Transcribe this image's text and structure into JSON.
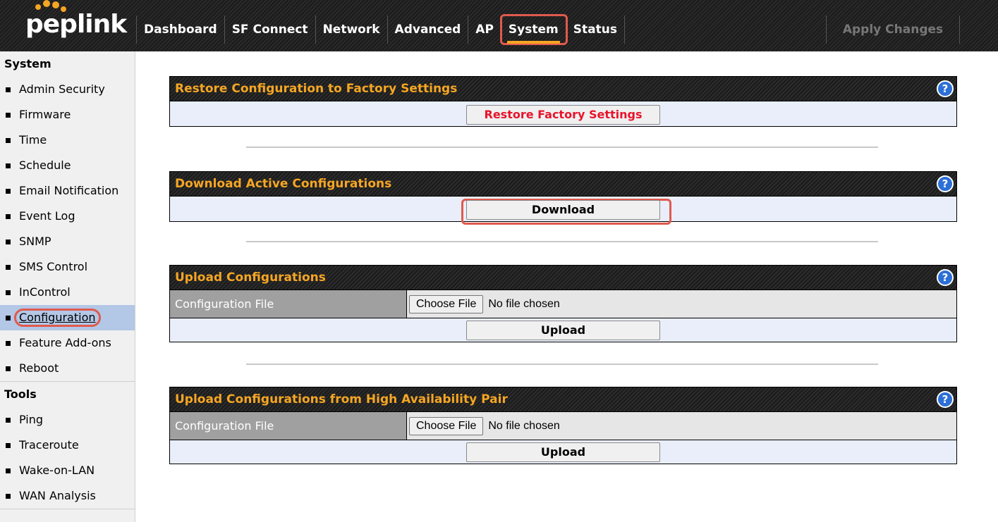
{
  "brand": {
    "logo_text": "peplink"
  },
  "nav": {
    "items": [
      "Dashboard",
      "SF Connect",
      "Network",
      "Advanced",
      "AP",
      "System",
      "Status"
    ],
    "active": "System",
    "apply_label": "Apply Changes"
  },
  "sidebar": {
    "sections": [
      {
        "title": "System",
        "items": [
          "Admin Security",
          "Firmware",
          "Time",
          "Schedule",
          "Email Notification",
          "Event Log",
          "SNMP",
          "SMS Control",
          "InControl",
          "Configuration",
          "Feature Add-ons",
          "Reboot"
        ]
      },
      {
        "title": "Tools",
        "items": [
          "Ping",
          "Traceroute",
          "Wake-on-LAN",
          "WAN Analysis"
        ]
      }
    ],
    "selected": "Configuration"
  },
  "panels": {
    "restore": {
      "title": "Restore Configuration to Factory Settings",
      "button": "Restore Factory Settings"
    },
    "download": {
      "title": "Download Active Configurations",
      "button": "Download"
    },
    "upload": {
      "title": "Upload Configurations",
      "field_label": "Configuration File",
      "choose_label": "Choose File",
      "file_status": "No file chosen",
      "button": "Upload"
    },
    "upload_ha": {
      "title": "Upload Configurations from High Availability Pair",
      "field_label": "Configuration File",
      "choose_label": "Choose File",
      "file_status": "No file chosen",
      "button": "Upload"
    }
  },
  "icons": {
    "help": "help-icon"
  },
  "colors": {
    "accent": "#f5a623",
    "danger": "#e8142b",
    "highlight": "#e05a4e",
    "selected_bg": "#b3c7e6",
    "help": "#2c6fd6"
  }
}
